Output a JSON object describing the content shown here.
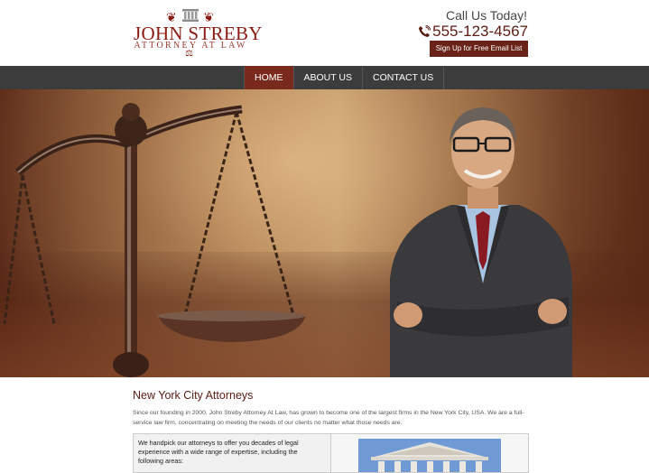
{
  "logo": {
    "name": "JOHN STREBY",
    "tagline": "ATTORNEY AT LAW"
  },
  "header": {
    "call_text": "Call Us Today!",
    "phone": "555-123-4567",
    "signup_label": "Sign Up for Free Email List"
  },
  "nav": {
    "items": [
      {
        "label": "HOME",
        "active": true
      },
      {
        "label": "ABOUT US",
        "active": false
      },
      {
        "label": "CONTACT US",
        "active": false
      }
    ]
  },
  "content": {
    "title": "New York City Attorneys",
    "intro": "Since our founding in 2000,  John Streby Attorney At Law, has grown to become one of the largest firms in the New York City, USA. We are a full-service law firm, concentrating on meeting the needs of our clients no matter what those needs are.",
    "box_text": "We handpick our attorneys to offer you decades of legal experience with a wide range of expertise, including the following areas:"
  },
  "colors": {
    "brand": "#8b1a12",
    "nav_bg": "#3c3c3c",
    "nav_active": "#7a2a1c",
    "button": "#6a2318"
  },
  "icons": {
    "phone": "phone-icon",
    "logo_pillar": "pillar-icon",
    "logo_laurel": "laurel-icon",
    "logo_scale": "scale-icon"
  }
}
